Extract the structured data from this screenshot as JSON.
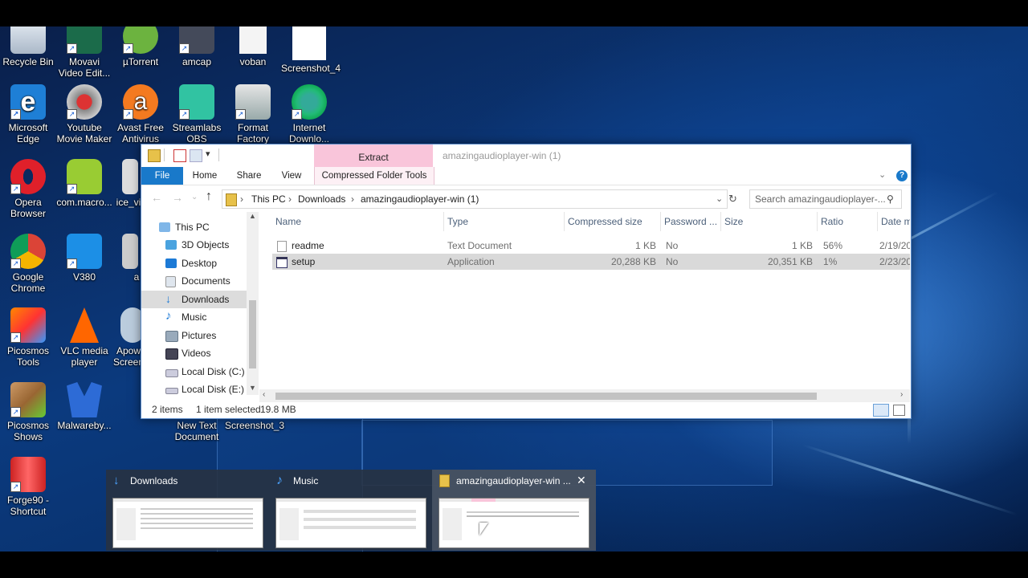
{
  "desktop": {
    "icons": [
      {
        "label": "Recycle Bin"
      },
      {
        "label": "Movavi Video Edit..."
      },
      {
        "label": "µTorrent"
      },
      {
        "label": "amcap"
      },
      {
        "label": "voban"
      },
      {
        "label": "Screenshot_4"
      },
      {
        "label": "Microsoft Edge"
      },
      {
        "label": "Youtube Movie Maker"
      },
      {
        "label": "Avast Free Antivirus"
      },
      {
        "label": "Streamlabs OBS"
      },
      {
        "label": "Format Factory"
      },
      {
        "label": "Internet Downlo..."
      },
      {
        "label": "Opera Browser"
      },
      {
        "label": "com.macro..."
      },
      {
        "label": "ice_vi"
      },
      {
        "label": "Google Chrome"
      },
      {
        "label": "V380"
      },
      {
        "label": "a"
      },
      {
        "label": "Picosmos Tools"
      },
      {
        "label": "VLC media player"
      },
      {
        "label": "Apow Screen"
      },
      {
        "label": "Picosmos Shows"
      },
      {
        "label": "Malwareby..."
      },
      {
        "label": "New Text Document"
      },
      {
        "label": "Screenshot_3"
      },
      {
        "label": "Forge90 - Shortcut"
      }
    ]
  },
  "explorer": {
    "title": "amazingaudioplayer-win (1)",
    "context_tab": "Extract",
    "ribbon_tabs": [
      "File",
      "Home",
      "Share",
      "View",
      "Compressed Folder Tools"
    ],
    "breadcrumb": [
      "This PC",
      "Downloads",
      "amazingaudioplayer-win (1)"
    ],
    "search_placeholder": "Search amazingaudioplayer-...",
    "nav_items": [
      "This PC",
      "3D Objects",
      "Desktop",
      "Documents",
      "Downloads",
      "Music",
      "Pictures",
      "Videos",
      "Local Disk (C:)",
      "Local Disk (E:)"
    ],
    "columns": [
      "Name",
      "Type",
      "Compressed size",
      "Password ...",
      "Size",
      "Ratio",
      "Date m"
    ],
    "files": [
      {
        "name": "readme",
        "type": "Text Document",
        "compressed": "1 KB",
        "password": "No",
        "size": "1 KB",
        "ratio": "56%",
        "date": "2/19/20"
      },
      {
        "name": "setup",
        "type": "Application",
        "compressed": "20,288 KB",
        "password": "No",
        "size": "20,351 KB",
        "ratio": "1%",
        "date": "2/23/20"
      }
    ],
    "status": {
      "items": "2 items",
      "selected": "1 item selected",
      "size": "19.8 MB"
    }
  },
  "taskbar_thumbs": [
    {
      "title": "Downloads"
    },
    {
      "title": "Music"
    },
    {
      "title": "amazingaudioplayer-win ...",
      "close": "✕"
    }
  ],
  "colors": {
    "file_tab": "#1979ca",
    "extract_tab": "#f9c5da",
    "selected_row": "#d9d9d9"
  }
}
